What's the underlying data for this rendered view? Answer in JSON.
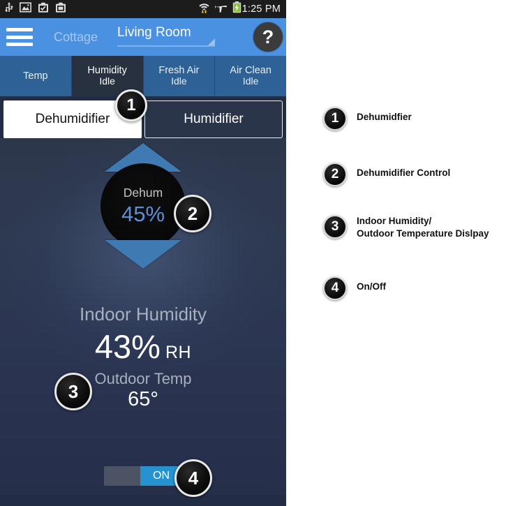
{
  "status_bar": {
    "icons_left": [
      "usb-icon",
      "image-icon",
      "screenshot-capture-icon",
      "screenshot-gallery-icon"
    ],
    "icons_right": [
      "wifi-transfer-icon",
      "airplane-mode-icon",
      "battery-charging-icon"
    ],
    "time": "1:25 PM"
  },
  "app_bar": {
    "menu_icon": "hamburger-menu-icon",
    "site_name": "Cottage",
    "zone_name": "Living Room",
    "zone_caret_icon": "dropdown-caret-icon",
    "help_label": "?"
  },
  "tabs": [
    {
      "label": "Temp",
      "sub": "",
      "active": false
    },
    {
      "label": "Humidity",
      "sub": "Idle",
      "active": true
    },
    {
      "label": "Fresh Air",
      "sub": "Idle",
      "active": false
    },
    {
      "label": "Air Clean",
      "sub": "Idle",
      "active": false
    }
  ],
  "mode_selector": {
    "selected_label": "Dehumidifier",
    "unselected_label": "Humidifier"
  },
  "control": {
    "up_arrow_icon": "increase-arrow-icon",
    "down_arrow_icon": "decrease-arrow-icon",
    "dial_label": "Dehum",
    "dial_value": "45%"
  },
  "readouts": {
    "indoor_title": "Indoor Humidity",
    "indoor_value": "43%",
    "indoor_unit": "RH",
    "outdoor_title": "Outdoor Temp",
    "outdoor_value": "65°"
  },
  "power_toggle": {
    "state_label": "ON"
  },
  "callouts": [
    {
      "number": "1",
      "label": "Dehumidfier"
    },
    {
      "number": "2",
      "label": "Dehumidifier Control"
    },
    {
      "number": "3",
      "label": "Indoor Humidity/\nOutdoor Temperature Dislpay"
    },
    {
      "number": "4",
      "label": "On/Off"
    }
  ],
  "colors": {
    "app_bar_blue": "#4b91e2",
    "tab_blue": "#2e6195",
    "tab_active_navy": "#27313f",
    "body_navy": "#2b3549",
    "arrow_blue": "#3d78b3",
    "dial_value_blue": "#5b8ed6",
    "toggle_on_blue": "#2392d0",
    "toggle_off_gray": "#4a5163",
    "status_bar_black": "#1c1c1c"
  }
}
